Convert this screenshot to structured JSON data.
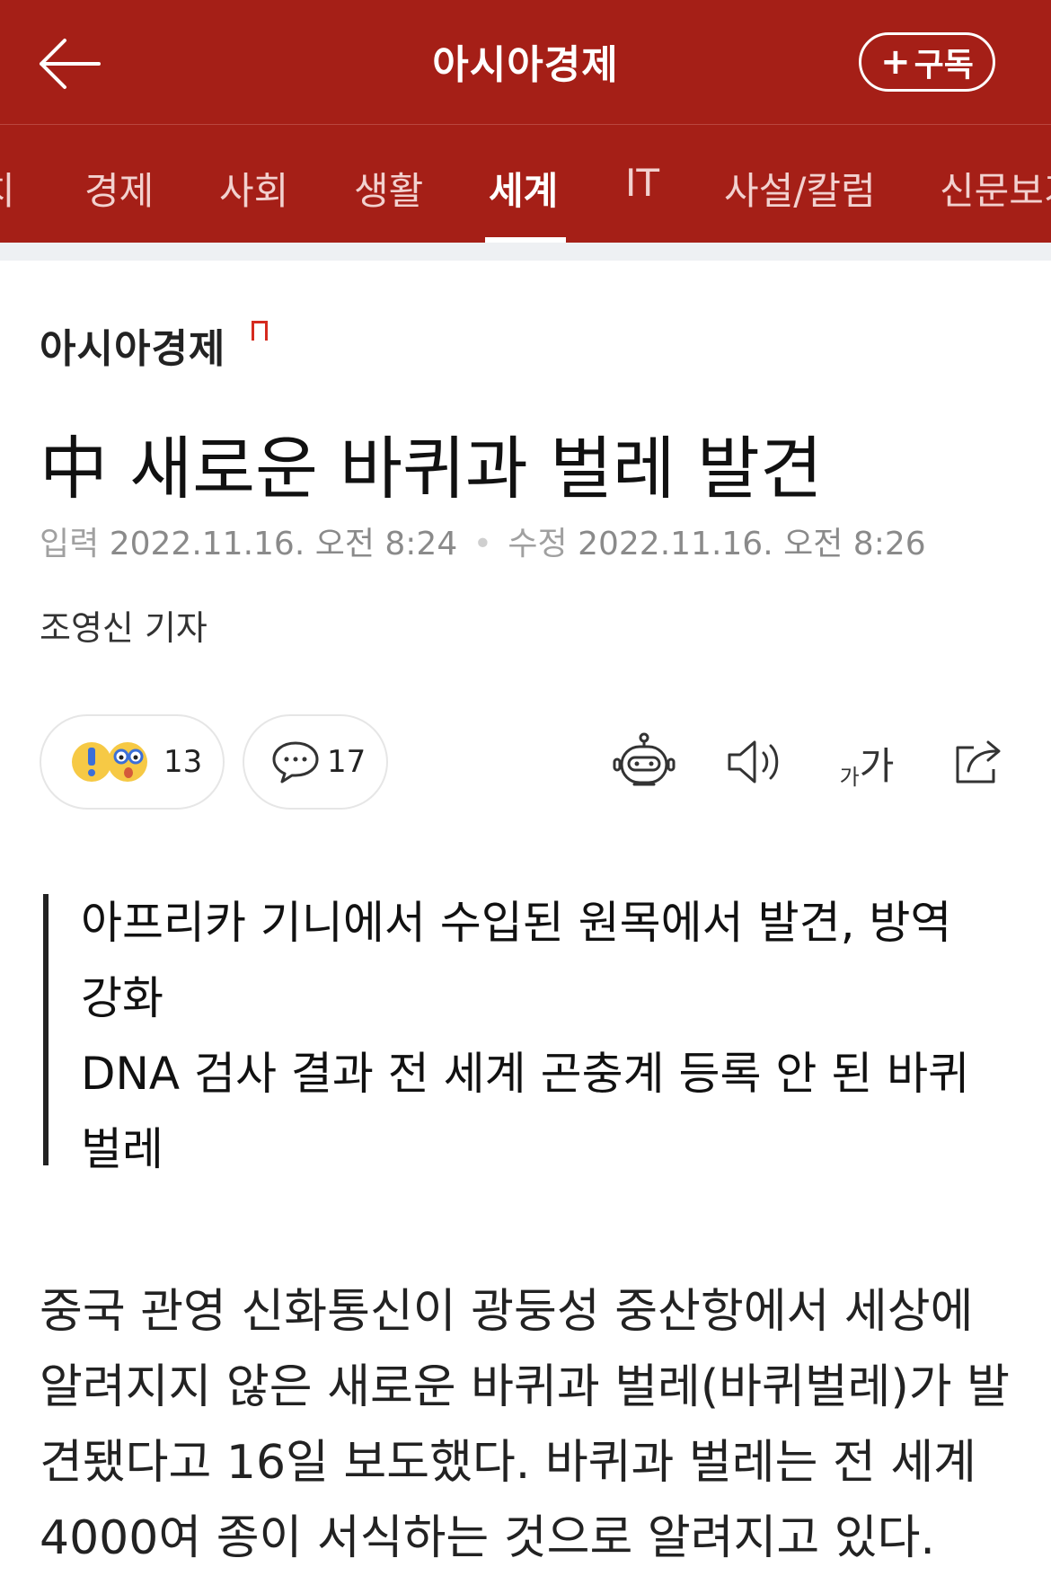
{
  "header": {
    "title": "아시아경제",
    "subscribe_label": "구독",
    "subscribe_plus": "+"
  },
  "nav": {
    "tabs": [
      {
        "label": "치"
      },
      {
        "label": "경제"
      },
      {
        "label": "사회"
      },
      {
        "label": "생활"
      },
      {
        "label": "세계"
      },
      {
        "label": "IT"
      },
      {
        "label": "사설/칼럼"
      },
      {
        "label": "신문보기"
      }
    ],
    "active_tab": "세계"
  },
  "article": {
    "publisher": "아시아경제",
    "headline": "中 새로운 바퀴과 벌레 발견",
    "input_label": "입력",
    "input_date": "2022.11.16. 오전 8:24",
    "edit_label": "수정",
    "edit_date": "2022.11.16. 오전 8:26",
    "reporter": "조영신 기자",
    "summary": [
      "아프리카 기니에서 수입된 원목에서 발견, 방역 강화",
      "DNA 검사 결과 전 세계 곤충계 등록 안 된 바퀴 벌레"
    ],
    "body": "중국 관영 신화통신이 광둥성 중산항에서 세상에 알려지지 않은 새로운 바퀴과 벌레(바퀴벌레)가 발견됐다고 16일 보도했다. 바퀴과 벌레는 전 세계 4000여 종이 서식하는 것으로 알려지고 있다."
  },
  "actions": {
    "reaction_count": "13",
    "comment_count": "17",
    "font_size_small": "가",
    "font_size_large": "가"
  },
  "colors": {
    "brand": "#a51f17",
    "logo_mark": "#d52a1e"
  }
}
